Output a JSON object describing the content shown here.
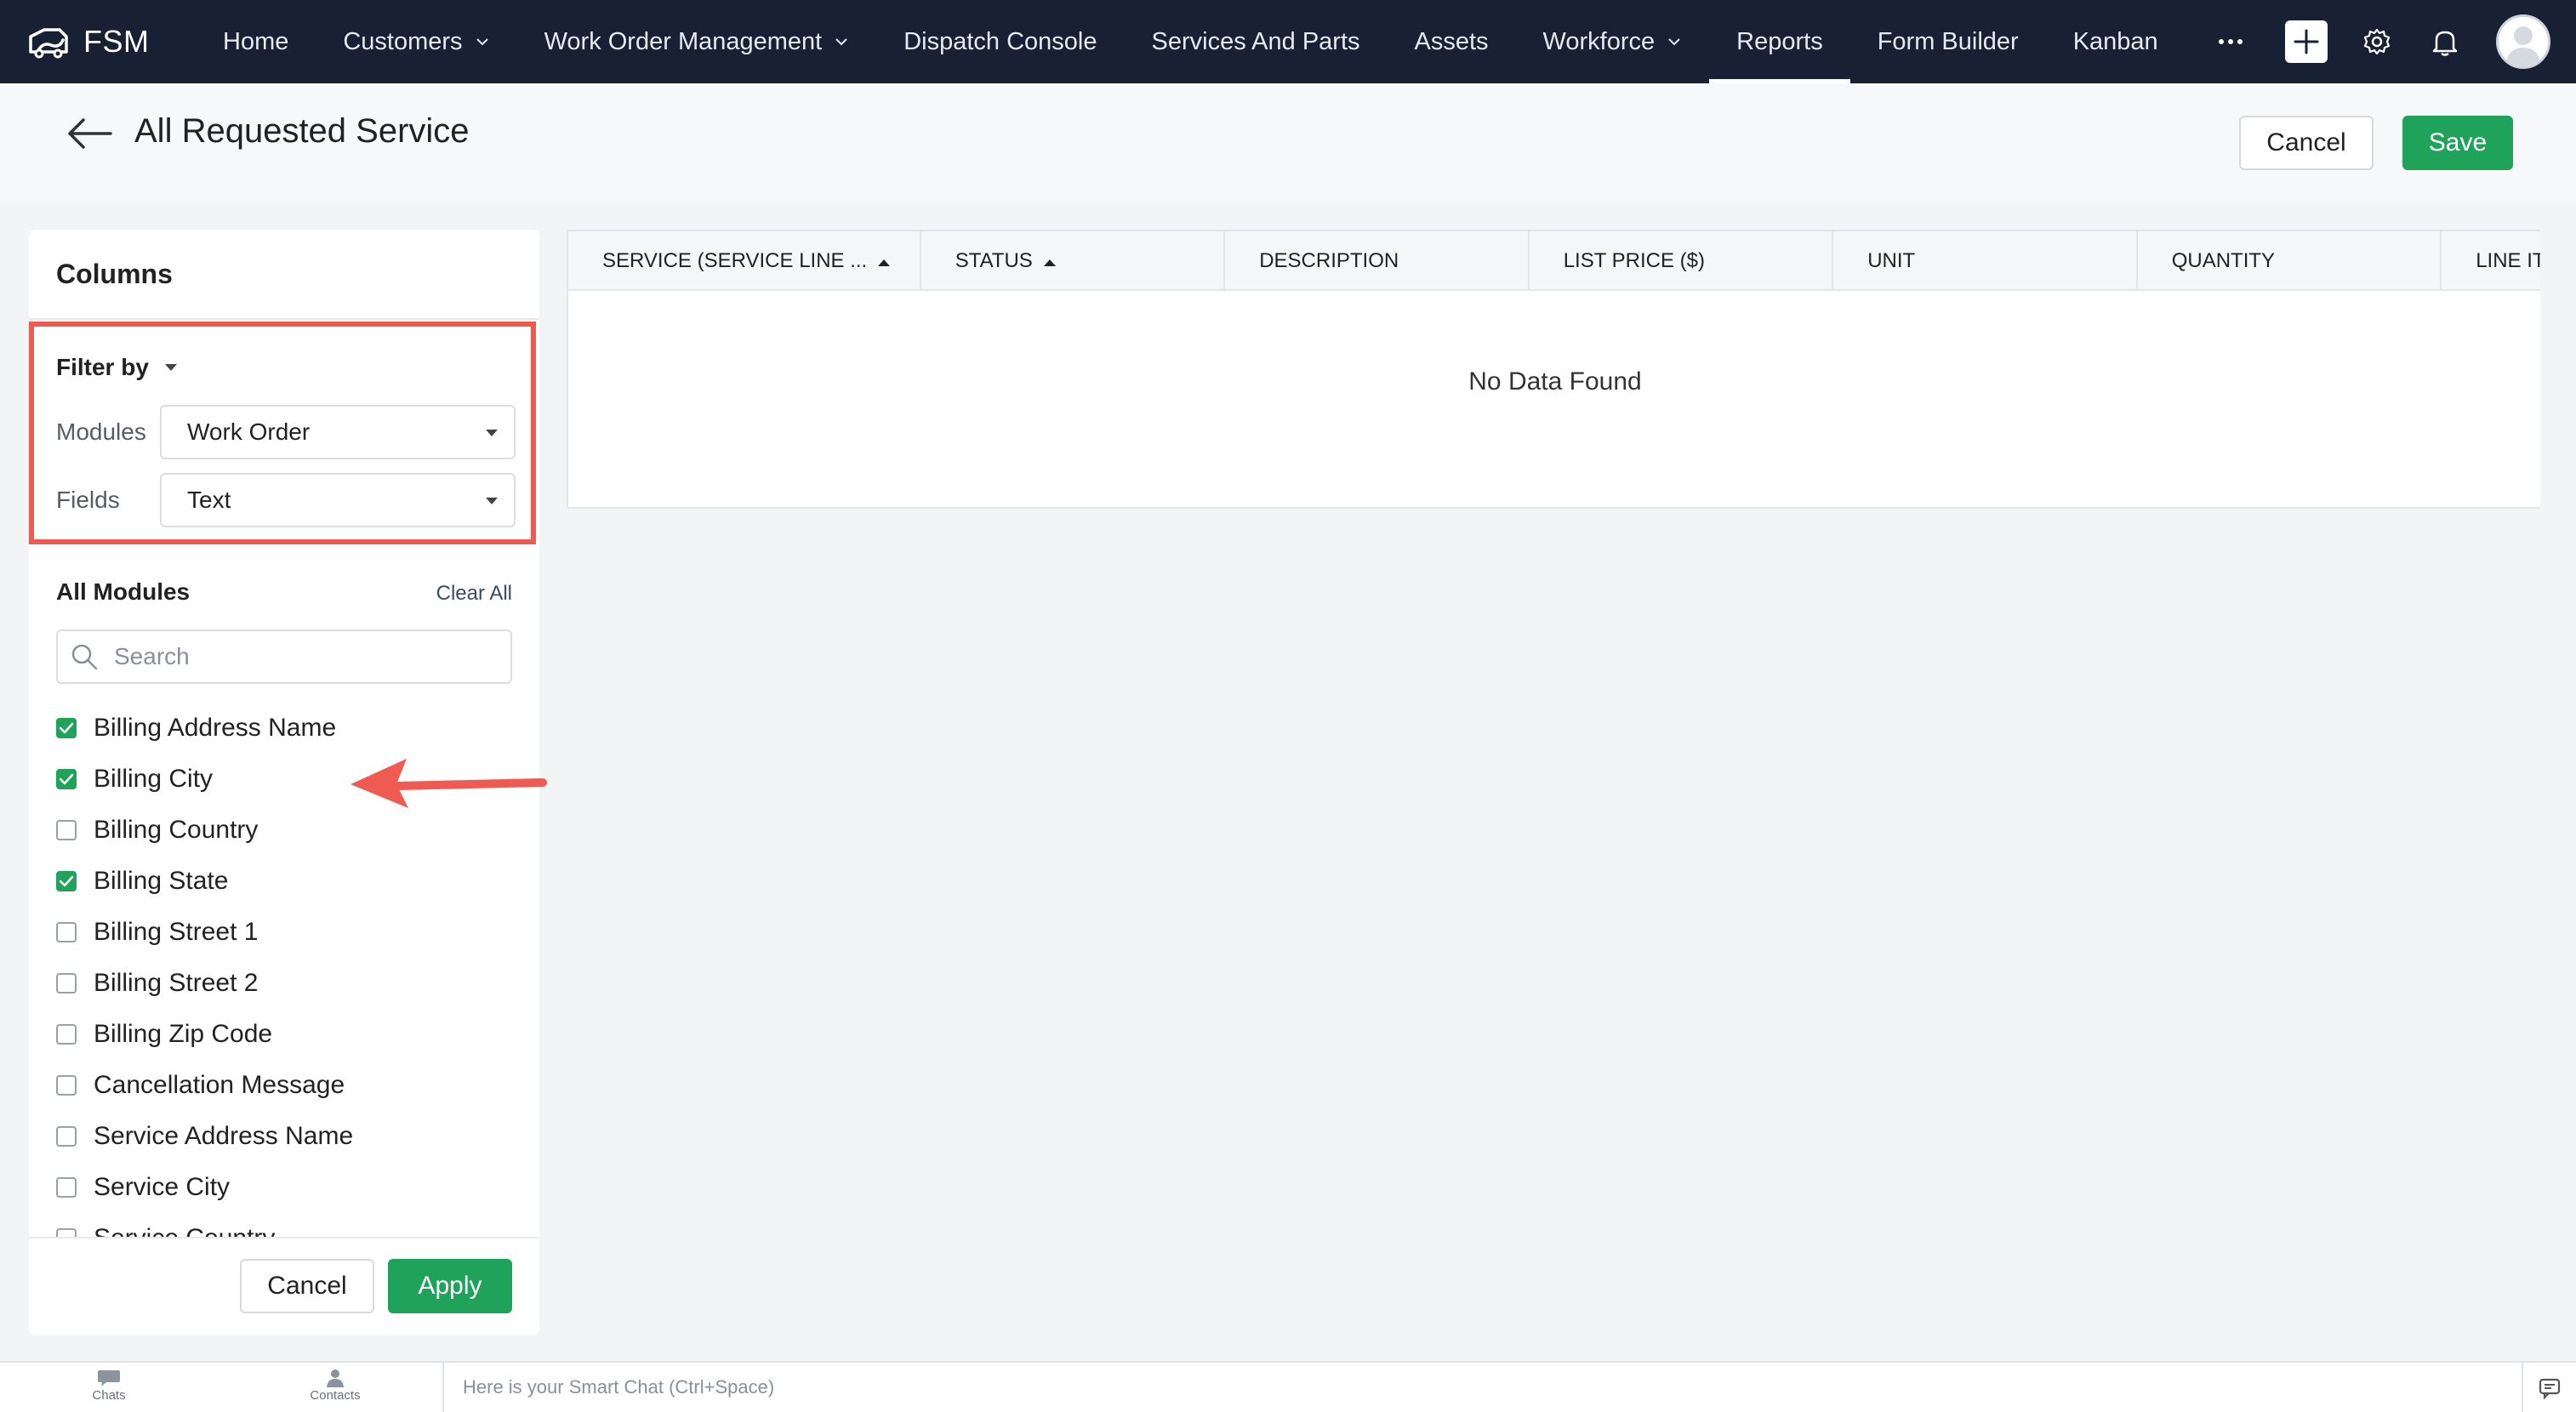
{
  "app": {
    "brand": "FSM"
  },
  "nav": {
    "items": [
      {
        "label": "Home",
        "has_dropdown": false,
        "active": false
      },
      {
        "label": "Customers",
        "has_dropdown": true,
        "active": false
      },
      {
        "label": "Work Order Management",
        "has_dropdown": true,
        "active": false
      },
      {
        "label": "Dispatch Console",
        "has_dropdown": false,
        "active": false
      },
      {
        "label": "Services And Parts",
        "has_dropdown": false,
        "active": false
      },
      {
        "label": "Assets",
        "has_dropdown": false,
        "active": false
      },
      {
        "label": "Workforce",
        "has_dropdown": true,
        "active": false
      },
      {
        "label": "Reports",
        "has_dropdown": false,
        "active": true
      },
      {
        "label": "Form Builder",
        "has_dropdown": false,
        "active": false
      },
      {
        "label": "Kanban",
        "has_dropdown": false,
        "active": false
      }
    ],
    "more_icon": "more-horizontal-icon",
    "right_icons": [
      "plus-icon",
      "gear-icon",
      "bell-icon",
      "avatar"
    ]
  },
  "header": {
    "title": "All Requested Service",
    "cancel_label": "Cancel",
    "save_label": "Save"
  },
  "columns_panel": {
    "title": "Columns",
    "filter_by_label": "Filter by",
    "modules_label": "Modules",
    "modules_value": "Work Order",
    "fields_label": "Fields",
    "fields_value": "Text",
    "all_modules_label": "All Modules",
    "clear_all_label": "Clear All",
    "search_placeholder": "Search",
    "fields": [
      {
        "label": "Billing Address Name",
        "checked": true
      },
      {
        "label": "Billing City",
        "checked": true
      },
      {
        "label": "Billing Country",
        "checked": false
      },
      {
        "label": "Billing State",
        "checked": true
      },
      {
        "label": "Billing Street 1",
        "checked": false
      },
      {
        "label": "Billing Street 2",
        "checked": false
      },
      {
        "label": "Billing Zip Code",
        "checked": false
      },
      {
        "label": "Cancellation Message",
        "checked": false
      },
      {
        "label": "Service Address Name",
        "checked": false
      },
      {
        "label": "Service City",
        "checked": false
      },
      {
        "label": "Service Country",
        "checked": false
      }
    ],
    "cancel_label": "Cancel",
    "apply_label": "Apply"
  },
  "table": {
    "columns": [
      {
        "label": "SERVICE (SERVICE LINE ...",
        "sort": true
      },
      {
        "label": "STATUS",
        "sort": true
      },
      {
        "label": "DESCRIPTION",
        "sort": false
      },
      {
        "label": "LIST PRICE ($)",
        "sort": false
      },
      {
        "label": "UNIT",
        "sort": false
      },
      {
        "label": "QUANTITY",
        "sort": false
      },
      {
        "label": "LINE ITEM A",
        "sort": false
      }
    ],
    "empty_text": "No Data Found"
  },
  "bottom_bar": {
    "chats_label": "Chats",
    "contacts_label": "Contacts",
    "smart_chat_text": "Here is your Smart Chat (Ctrl+Space)"
  },
  "colors": {
    "nav_bg": "#172133",
    "accent_green": "#1fa35a",
    "highlight_red": "#ef5a51"
  }
}
